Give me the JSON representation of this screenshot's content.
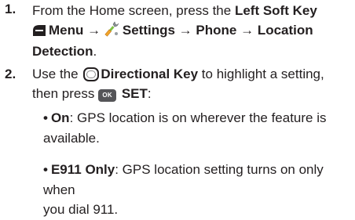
{
  "steps": [
    {
      "number": "1.",
      "line1_text": "From the Home screen, press the ",
      "line1_bold": "Left Soft Key",
      "line2_menu": "Menu",
      "arrow": "→",
      "line2_settings": "Settings",
      "line2_phone": "Phone",
      "line2_location": "Location",
      "line3_detection": "Detection",
      "line3_period": ".",
      "icons": [
        "left-soft-key-icon",
        "settings-icon"
      ]
    },
    {
      "number": "2.",
      "line1_text_a": "Use the ",
      "line1_bold": "Directional Key",
      "line1_text_b": " to highlight a setting,",
      "line2_text": "then press ",
      "ok_key_label": "OK",
      "line2_bold": "SET",
      "line2_colon": ":",
      "icons": [
        "directional-key-icon",
        "ok-key-icon"
      ]
    }
  ],
  "bullets": [
    {
      "dot": "•",
      "term": "On",
      "desc_line1": ": GPS location is on wherever the feature is",
      "desc_line2": "available."
    },
    {
      "dot": "•",
      "term": "E911 Only",
      "desc_line1": ": GPS location setting turns on only when",
      "desc_line2": "you dial 911."
    }
  ]
}
